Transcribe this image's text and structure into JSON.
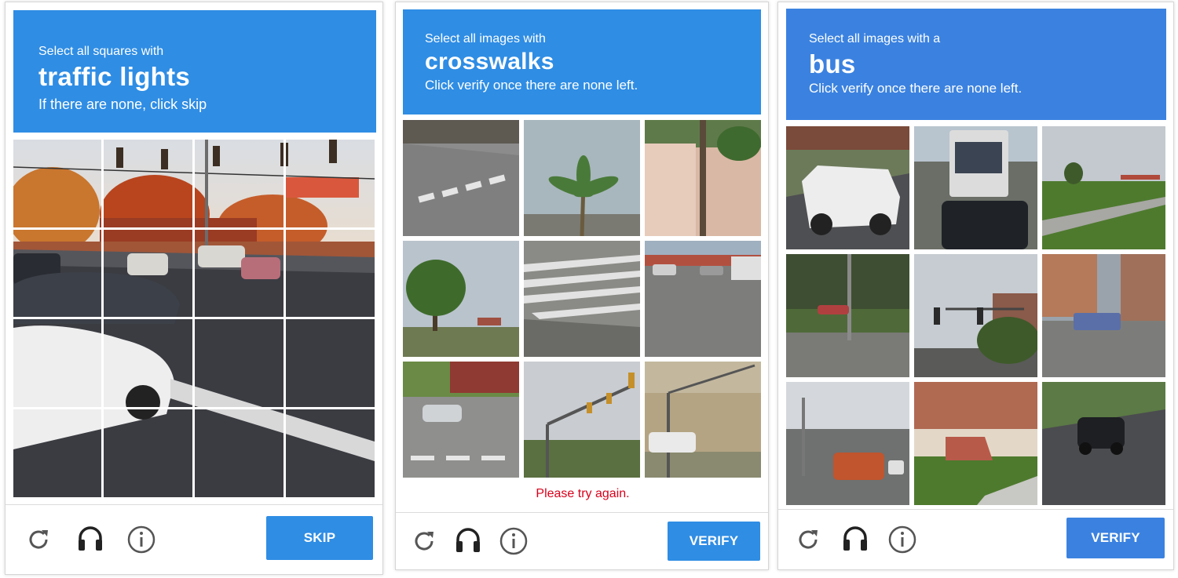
{
  "colors": {
    "header": "#2f8de4",
    "button": "#2f8de4",
    "header_bus": "#3b82e0",
    "error": "#d9001b"
  },
  "challenges": [
    {
      "prompt_small": "Select all squares with",
      "prompt_target": "traffic lights",
      "prompt_hint": "If there are none, click skip",
      "button_label": "SKIP",
      "icons": [
        "reload-icon",
        "audio-icon",
        "info-icon"
      ]
    },
    {
      "prompt_small": "Select all images with",
      "prompt_target": "crosswalks",
      "prompt_hint": "Click verify once there are none left.",
      "error_text": "Please try again.",
      "button_label": "VERIFY",
      "icons": [
        "reload-icon",
        "audio-icon",
        "info-icon"
      ]
    },
    {
      "prompt_small": "Select all images with a",
      "prompt_target": "bus",
      "prompt_hint": "Click verify once there are none left.",
      "button_label": "VERIFY",
      "icons": [
        "reload-icon",
        "audio-icon",
        "info-icon"
      ]
    }
  ]
}
